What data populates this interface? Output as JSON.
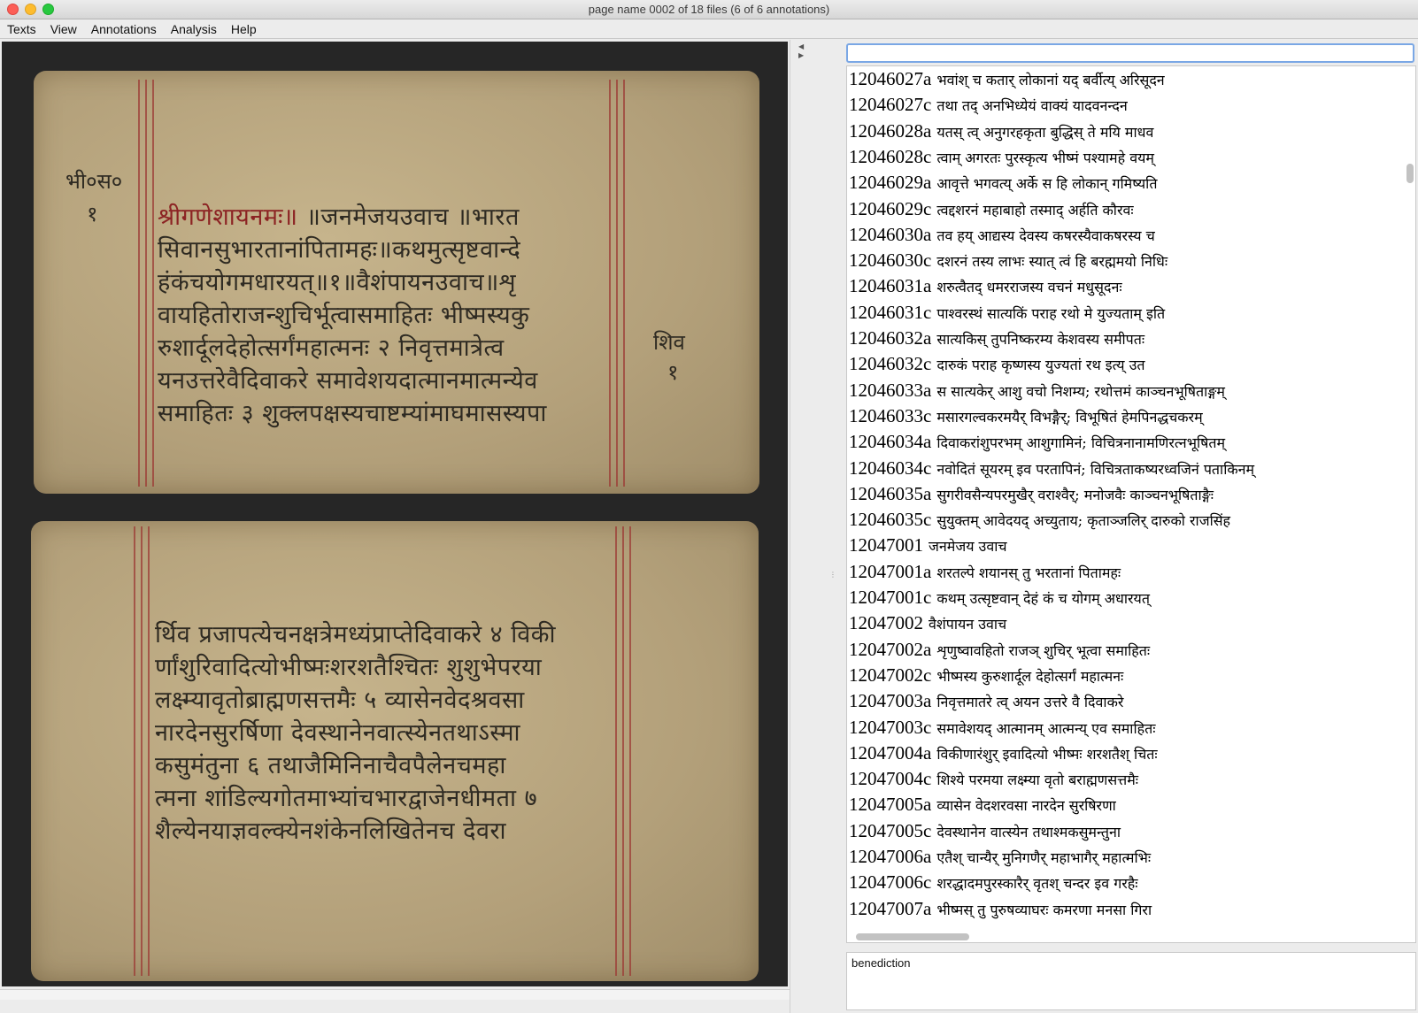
{
  "window": {
    "title": "page name 0002 of 18 files (6 of 6 annotations)"
  },
  "menu": [
    "Texts",
    "View",
    "Annotations",
    "Analysis",
    "Help"
  ],
  "manuscript": {
    "top_leaf_lines": [
      {
        "red": "श्रीगणेशायनमः॥",
        "rest": " ॥जनमेजयउवाच ॥भारत"
      },
      {
        "red": "",
        "rest": "सिवानसुभारतानांपितामहः॥कथमुत्सृष्टवान्दे"
      },
      {
        "red": "",
        "rest": "हंकंचयोगमधारयत्॥१॥वैशंपायनउवाच॥शृ"
      },
      {
        "red": "",
        "rest": "वायहितोराजन्शुचिर्भूत्वासमाहितः भीष्मस्यकु"
      },
      {
        "red": "",
        "rest": "रुशार्दूलदेहोत्सर्गंमहात्मनः २ निवृत्तमात्रेत्व"
      },
      {
        "red": "",
        "rest": "यनउत्तरेवैदिवाकरे समावेशयदात्मानमात्मन्येव"
      },
      {
        "red": "",
        "rest": "समाहितः ३ शुक्लपक्षस्यचाष्टम्यांमाघमासस्यपा"
      }
    ],
    "top_margin_left": "भी०स०",
    "top_margin_left_num": "१",
    "top_margin_right": "शिव",
    "top_margin_right_num": "१",
    "bottom_leaf_lines": [
      "र्थिव प्रजापत्येचनक्षत्रेमध्यंप्राप्तेदिवाकरे ४ विकी",
      "र्णांशुरिवादित्योभीष्मःशरशतैश्चितः शुशुभेपरया",
      "लक्ष्म्यावृतोब्राह्मणसत्तमैः ५ व्यासेनवेदश्रवसा",
      "नारदेनसुरर्षिणा देवस्थानेनवात्स्येनतथाऽस्मा",
      "कसुमंतुना ६ तथाजैमिनिनाचैवपैलेनचमहा",
      "त्मना शांडिल्यगोतमाभ्यांचभारद्वाजेनधीमता ७",
      "शैल्येनयाज्ञवल्क्येनशंकेनलिखितेनच देवरा"
    ]
  },
  "search": {
    "value": "",
    "placeholder": ""
  },
  "verse_list": [
    {
      "id": "12046027a",
      "text": "भवांश् च कतार् लोकानां यद् बर्वीत्य् अरिसूदन"
    },
    {
      "id": "12046027c",
      "text": "तथा तद् अनभिध्येयं वाक्यं यादवनन्दन"
    },
    {
      "id": "12046028a",
      "text": "यतस् त्व् अनुगरहकृता बुद्धिस् ते मयि माधव"
    },
    {
      "id": "12046028c",
      "text": "त्वाम् अगरतः पुरस्कृत्य भीष्मं पश्यामहे वयम्"
    },
    {
      "id": "12046029a",
      "text": "आवृत्ते भगवत्य् अर्के स हि लोकान् गमिष्यति"
    },
    {
      "id": "12046029c",
      "text": "त्वद्दशरनं महाबाहो तस्माद् अर्हति कौरवः"
    },
    {
      "id": "12046030a",
      "text": "तव हय् आद्यस्य देवस्य कषरस्यैवाकषरस्य च"
    },
    {
      "id": "12046030c",
      "text": "दशरनं तस्य लाभः स्यात् त्वं हि बरह्ममयो निधिः"
    },
    {
      "id": "12046031a",
      "text": "शरुत्वैतद् धमरराजस्य वचनं मधुसूदनः"
    },
    {
      "id": "12046031c",
      "text": "पाश्वरस्थं सात्यकिं पराह रथो मे युज्यताम् इति"
    },
    {
      "id": "12046032a",
      "text": "सात्यकिस् तुपनिष्करम्य केशवस्य समीपतः"
    },
    {
      "id": "12046032c",
      "text": "दारुकं पराह कृष्णस्य युज्यतां रथ इत्य् उत"
    },
    {
      "id": "12046033a",
      "text": "स सात्यकेर् आशु वचो निशम्य; रथोत्तमं काञ्चनभूषिताङ्गम्"
    },
    {
      "id": "12046033c",
      "text": "मसारगल्वकरमयैर् विभङ्गैर्; विभूषितं हेमपिनद्धचकरम्"
    },
    {
      "id": "12046034a",
      "text": "दिवाकरांशुपरभम् आशुगामिनं; विचित्रनानामणिरत्नभूषितम्"
    },
    {
      "id": "12046034c",
      "text": "नवोदितं सूयरम् इव परतापिनं; विचित्रताकष्यरध्वजिनं पताकिनम्"
    },
    {
      "id": "12046035a",
      "text": "सुगरीवसैन्यपरमुखैर् वराश्वैर्; मनोजवैः काञ्चनभूषिताङ्गैः"
    },
    {
      "id": "12046035c",
      "text": "सुयुक्तम् आवेदयद् अच्युताय; कृताञ्जलिर् दारुको राजसिंह"
    },
    {
      "id": "12047001",
      "text": " जनमेजय उवाच"
    },
    {
      "id": "12047001a",
      "text": "शरतल्पे शयानस् तु भरतानां पितामहः"
    },
    {
      "id": "12047001c",
      "text": "कथम् उत्सृष्टवान् देहं कं च योगम् अधारयत्"
    },
    {
      "id": "12047002",
      "text": " वैशंपायन उवाच"
    },
    {
      "id": "12047002a",
      "text": "शृणुष्वावहितो राजञ् शुचिर् भूत्वा समाहितः"
    },
    {
      "id": "12047002c",
      "text": "भीष्मस्य कुरुशार्दूल देहोत्सर्गं महात्मनः"
    },
    {
      "id": "12047003a",
      "text": "निवृत्तमातरे त्व् अयन उत्तरे वै दिवाकरे"
    },
    {
      "id": "12047003c",
      "text": "समावेशयद् आत्मानम् आत्मन्य् एव समाहितः"
    },
    {
      "id": "12047004a",
      "text": "विकीणारंशुर् इवादित्यो भीष्मः शरशतैश् चितः"
    },
    {
      "id": "12047004c",
      "text": "शिश्ये परमया लक्ष्म्या वृतो बराह्मणसत्तमैः"
    },
    {
      "id": "12047005a",
      "text": "व्यासेन वेदशरवसा नारदेन सुरषिरणा"
    },
    {
      "id": "12047005c",
      "text": "देवस्थानेन वात्स्येन तथाश्मकसुमन्तुना"
    },
    {
      "id": "12047006a",
      "text": "एतैश् चान्यैर् मुनिगणैर् महाभागैर् महात्मभिः"
    },
    {
      "id": "12047006c",
      "text": "शरद्धादमपुरस्कारैर् वृतश् चन्दर इव गरहैः"
    },
    {
      "id": "12047007a",
      "text": "भीष्मस् तु पुरुषव्याघरः कमरणा मनसा गिरा"
    }
  ],
  "annotation_note": "benediction"
}
